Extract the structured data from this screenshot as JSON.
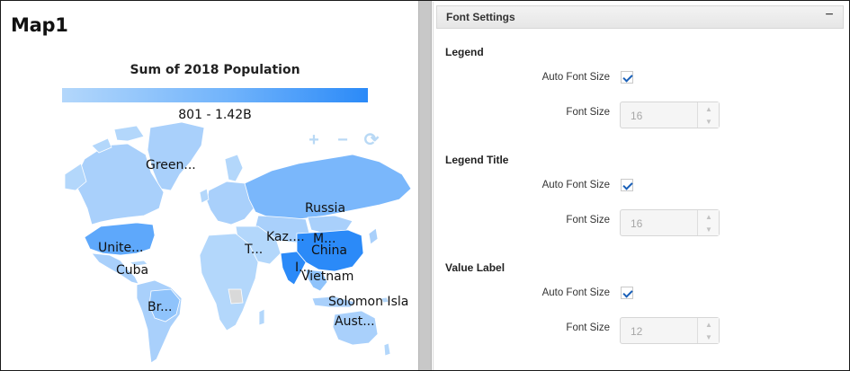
{
  "map": {
    "title": "Map1",
    "legend_title": "Sum of 2018 Population",
    "legend_range": "801 - 1.42B",
    "zoom_in": "+",
    "zoom_out": "−",
    "reset": "⟳",
    "labels": {
      "greenland": "Green...",
      "russia": "Russia",
      "united_states": "Unite...",
      "cuba": "Cuba",
      "kazakhstan": "Kaz....",
      "mongolia": "M...",
      "china": "China",
      "turkey": "T...",
      "india": "I...",
      "vietnam": "Vietnam",
      "solomon_islands": "Solomon Isla",
      "brazil": "Br...",
      "australia": "Aust..."
    },
    "colors": {
      "low": "#b3d7fb",
      "mid": "#70b3fb",
      "high": "#2b8af8",
      "no_data": "#d9d9d9"
    }
  },
  "settings": {
    "header_title": "Font Settings",
    "collapse_symbol": "−",
    "sections": {
      "legend": {
        "title": "Legend",
        "auto_label": "Auto Font Size",
        "size_label": "Font Size",
        "size_value": "16",
        "auto_checked": true
      },
      "legend_title": {
        "title": "Legend Title",
        "auto_label": "Auto Font Size",
        "size_label": "Font Size",
        "size_value": "16",
        "auto_checked": true
      },
      "value_label": {
        "title": "Value Label",
        "auto_label": "Auto Font Size",
        "size_label": "Font Size",
        "size_value": "12",
        "auto_checked": true
      }
    }
  }
}
